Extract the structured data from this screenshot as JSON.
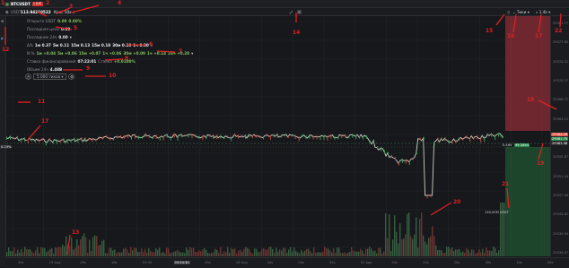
{
  "header": {
    "symbol_tab": "BTCUSDT",
    "tab_badge": "LIVE",
    "pair": "USDT",
    "pair_value": "113.94210522",
    "mode_label": "Крос 50x",
    "view_options": [
      "Тики",
      "1.4k"
    ]
  },
  "info_rows": {
    "open_usdt": {
      "label": "Открыто USDT",
      "value": "0.00",
      "pct": "0.00%"
    },
    "last_price": {
      "label": "Последняя цена",
      "value": "0.00"
    },
    "last_24h": {
      "label": "Последние 24ч",
      "value": "0.00"
    },
    "change_series": {
      "label": "Δ%",
      "items": [
        "1м 0.37",
        "5м 0.11",
        "15м 0.13",
        "15м 0.18",
        "30м 0.18",
        "1ч 0.30"
      ]
    },
    "natr_series": {
      "label": "N %",
      "items": [
        "1м +0.04",
        "5м +0.06",
        "15м +0.07",
        "1ч +0.06",
        "30м +0.09",
        "1ч +0.14",
        "24ч +0.28"
      ]
    },
    "funding": {
      "label": "Ставка финансирования",
      "time": "07:22:01",
      "rate_label": "Ставка",
      "rate": "+0.0100%"
    },
    "volume_24h": {
      "label": "Объем 24ч",
      "value": "4.48B"
    },
    "timeframe_label": "5 000 тиков"
  },
  "annotations": [
    "1",
    "2",
    "3",
    "4",
    "5",
    "6",
    "7",
    "8",
    "9",
    "10",
    "11",
    "12",
    "13",
    "14",
    "15",
    "16",
    "17",
    "18",
    "19",
    "20",
    "21",
    "22"
  ],
  "price_axis": {
    "ticks": [
      "29381.77",
      "29377.80",
      "29374.22",
      "29370.57",
      "29366.72",
      "29363.12",
      "29359.53",
      "29355.87",
      "29351.44",
      "29347.46",
      "29343.82",
      "29339.93",
      "29336.07"
    ],
    "current_price_tag": "29363.38",
    "bid_tag": "29361.75",
    "ask_tag": "29364.26",
    "left_price_tag": "0.23%",
    "mid_price_tag": "99.3494",
    "orderbook_tag": "0.464"
  },
  "time_axis": {
    "ticks": [
      "34s",
      "19 Aug",
      "09s",
      "18s",
      "03:00",
      "03:54:30",
      "05s",
      "28 Aug",
      "34s",
      "04s",
      "52s",
      "52 Ago",
      "53s",
      "25s",
      "26s",
      "30s",
      "34s",
      "06s"
    ],
    "highlighted": "03:54:30"
  },
  "volume_label": "130,50M USDT",
  "colors": {
    "up": "#7fc35a",
    "down": "#e0533f",
    "accent": "#2a8a4a",
    "bg": "#17181b"
  }
}
